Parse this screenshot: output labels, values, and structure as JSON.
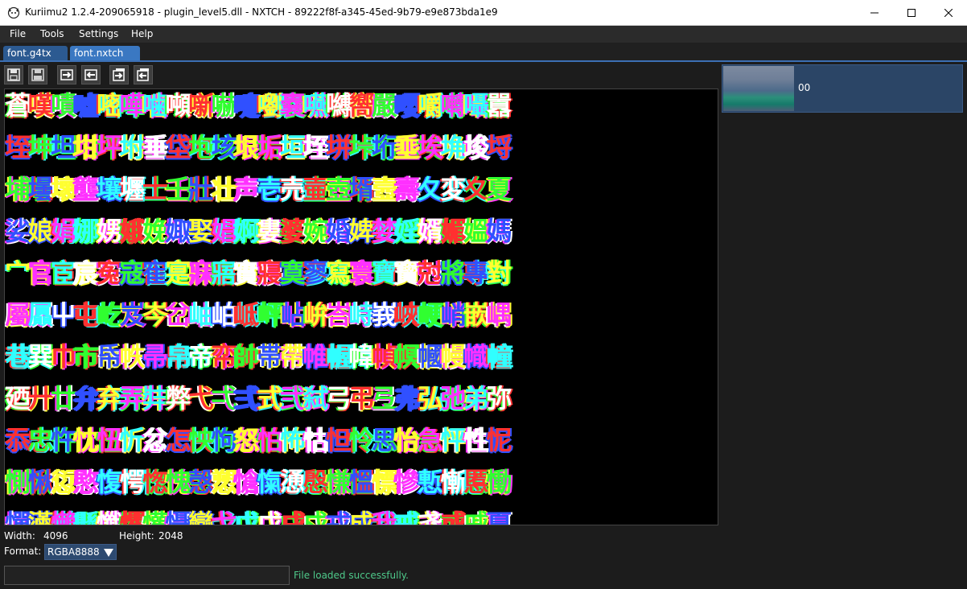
{
  "window": {
    "title": "Kuriimu2 1.2.4-209065918 - plugin_level5.dll - NXTCH - 89222f8f-a345-45ed-9b79-e9e873bda1e9",
    "minimize_icon": "minimize-icon",
    "maximize_icon": "maximize-icon",
    "close_icon": "close-icon"
  },
  "menu": [
    "File",
    "Tools",
    "Settings",
    "Help"
  ],
  "tabs": [
    {
      "label": "font.g4tx",
      "active": false
    },
    {
      "label": "font.nxtch",
      "active": true
    }
  ],
  "toolbar": {
    "buttons": [
      "save-icon",
      "save-as-icon",
      "export-icon",
      "import-icon",
      "export-all-icon",
      "import-all-icon"
    ]
  },
  "image_list": [
    {
      "label": "00"
    }
  ],
  "glyph_rows": [
    "蒼嘆嘖嘘嘧嘩噛噸噺嚇嚏嚠嚢嚥嚩嚮嚴嚶嚼囀囁囂",
    "垤坤坦坩坪坿垂垈垉垓垠垢垣垤垪垰垳埀埃埆埈埒",
    "埔壜壞壟壤壥士壬壯壮声壱売壷壺壻壼壽夂変夊夏",
    "娑娘娟娜娚娥娩娵娶娼婀婁婆婉婚婢婪婬婿媚媼媽",
    "宀官宦宸寃寇寉寔寐寤實寢寞寥寫寰寶寳尅將專對",
    "屬屭屮屯屹岌岑岔岫岶岻岼岾峅峇峙峩峽峺峭嵌嵎",
    "巷巽巾市帋帙帚帛帝帟帥帯帶帷幄幃幀幎幗幔幟幢",
    "廼廾廿弁弃弄弉弊弋弌弍式弐弑弓弔弖弗弘弛弟弥",
    "忝忠忤忱忸忻忿怎怏怐怒怕怖怙怛怜思怡急怦性怩",
    "惻愀愆愍愎愕愡愧愨愬愴愾慂慇慊慍慓慘慙慚慝慟",
    "憚懣懶懸懺懼懽懾戀戈戉戊戌戍戎成我戒戔或戚戛"
  ],
  "image_info": {
    "width_label": "Width:",
    "width_value": "4096",
    "height_label": "Height:",
    "height_value": "2048",
    "format_label": "Format:",
    "format_value": "RGBA8888"
  },
  "status": {
    "input_value": "",
    "message": "File loaded successfully."
  }
}
